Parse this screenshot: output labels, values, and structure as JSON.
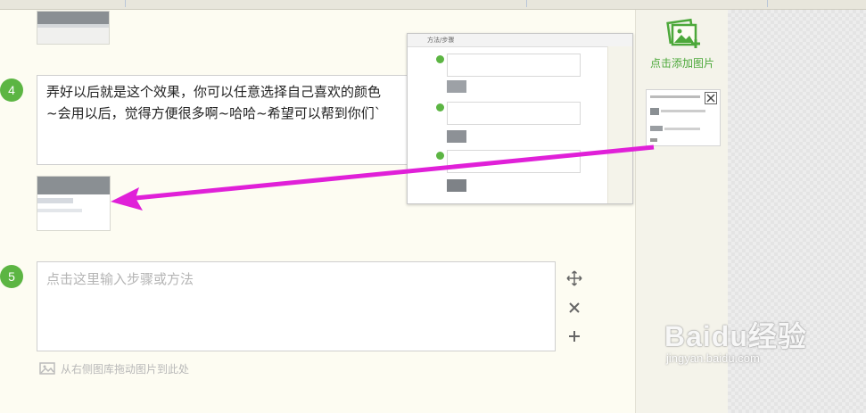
{
  "steps": [
    {
      "number": "4",
      "text": "弄好以后就是这个效果，你可以任意选择自己喜欢的颜色\n~会用以后，觉得方便很多啊~哈哈~希望可以帮到你们`"
    },
    {
      "number": "5",
      "placeholder": "点击这里输入步骤或方法"
    }
  ],
  "tools": {
    "move_icon": "move-icon",
    "delete_icon": "delete-icon",
    "add_icon": "add-icon"
  },
  "hint": "从右侧图库拖动图片到此处",
  "sidebar": {
    "add_picture_label": "点击添加图片"
  },
  "popup": {
    "header": "方法/步骤"
  },
  "watermark": {
    "brand": "Baidu经验",
    "url": "jingyan.baidu.com"
  },
  "colors": {
    "accent_green": "#5cb543",
    "arrow_magenta": "#e020d8",
    "background": "#fdfcf2"
  }
}
